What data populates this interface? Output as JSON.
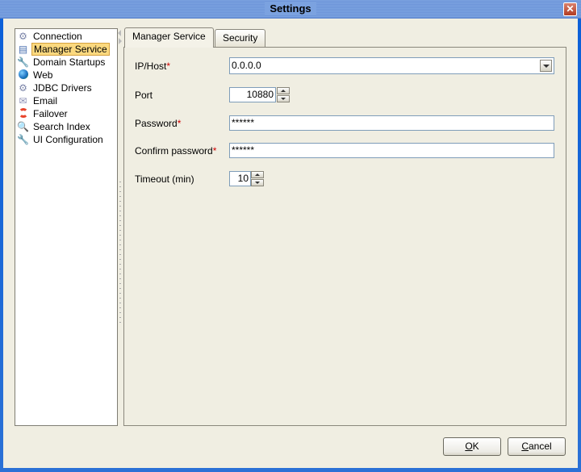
{
  "window": {
    "title": "Settings",
    "close_icon": "close-icon"
  },
  "sidebar": {
    "items": [
      {
        "label": "Connection",
        "icon": "connection-gear-icon",
        "selected": false
      },
      {
        "label": "Manager Service",
        "icon": "manager-service-icon",
        "selected": true
      },
      {
        "label": "Domain Startups",
        "icon": "wrench-icon",
        "selected": false
      },
      {
        "label": "Web",
        "icon": "globe-icon",
        "selected": false
      },
      {
        "label": "JDBC Drivers",
        "icon": "gears-icon",
        "selected": false
      },
      {
        "label": "Email",
        "icon": "envelope-icon",
        "selected": false
      },
      {
        "label": "Failover",
        "icon": "lifebuoy-icon",
        "selected": false
      },
      {
        "label": "Search Index",
        "icon": "search-index-icon",
        "selected": false
      },
      {
        "label": "UI Configuration",
        "icon": "wrench-icon",
        "selected": false
      }
    ]
  },
  "tabs": [
    {
      "label": "Manager Service",
      "active": true
    },
    {
      "label": "Security",
      "active": false
    }
  ],
  "form": {
    "ip_host": {
      "label": "IP/Host",
      "required": "*",
      "value": "0.0.0.0"
    },
    "port": {
      "label": "Port",
      "value": "10880"
    },
    "password": {
      "label": "Password",
      "required": "*",
      "value": "******"
    },
    "confirm_password": {
      "label": "Confirm password",
      "required": "*",
      "value": "******"
    },
    "timeout": {
      "label": "Timeout (min)",
      "value": "10"
    }
  },
  "buttons": {
    "ok": {
      "mnemonic": "O",
      "rest": "K"
    },
    "cancel": {
      "mnemonic": "C",
      "rest": "ancel"
    }
  },
  "colors": {
    "required": "#d00000",
    "selection": "#fbd97f",
    "titlebar": "#7ba2e0"
  }
}
